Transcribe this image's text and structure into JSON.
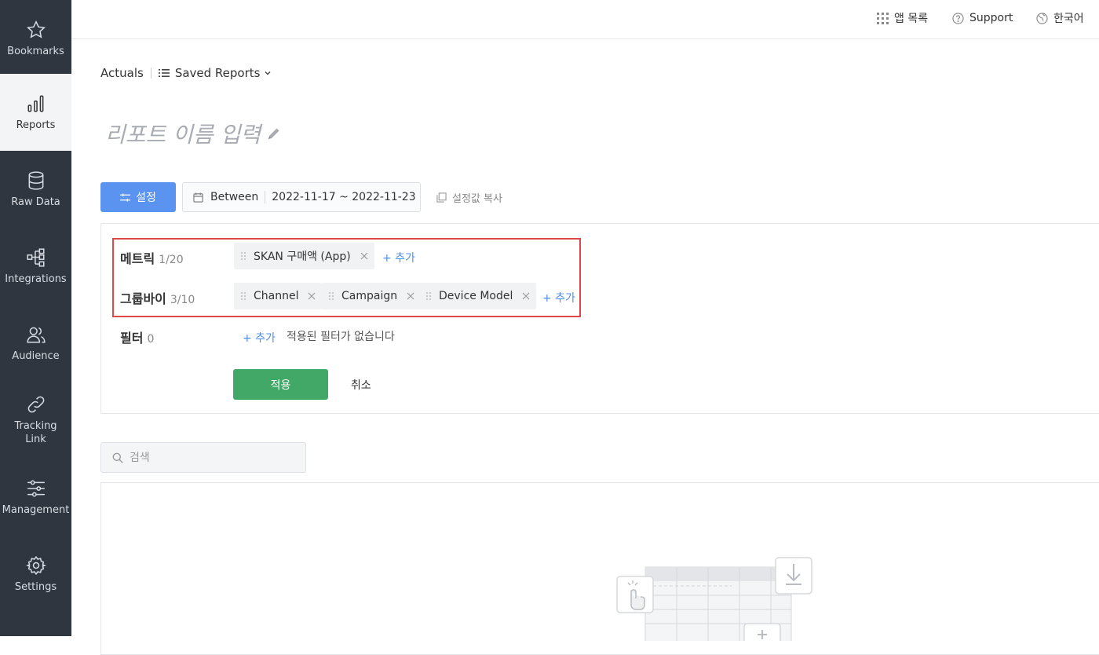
{
  "sidebar": {
    "items": [
      {
        "label": "Bookmarks",
        "icon": "star-icon"
      },
      {
        "label": "Reports",
        "icon": "bar-chart-icon"
      },
      {
        "label": "Raw Data",
        "icon": "database-icon"
      },
      {
        "label": "Integrations",
        "icon": "network-icon"
      },
      {
        "label": "Audience",
        "icon": "users-icon"
      },
      {
        "label": "Tracking Link",
        "icon": "link-icon"
      },
      {
        "label": "Management",
        "icon": "sliders-icon"
      },
      {
        "label": "Settings",
        "icon": "gear-icon"
      }
    ],
    "active": "Reports"
  },
  "topbar": {
    "apps_label": "앱 목록",
    "support_label": "Support",
    "language_label": "한국어"
  },
  "breadcrumb": {
    "current": "Actuals",
    "saved_reports_label": "Saved Reports"
  },
  "report": {
    "title_placeholder": "리포트 이름 입력"
  },
  "toolbar": {
    "settings_label": "설정",
    "date_mode": "Between",
    "date_range": "2022-11-17 ~ 2022-11-23",
    "copy_label": "설정값 복사"
  },
  "config": {
    "metrics": {
      "label": "메트릭",
      "count": "1/20",
      "chips": [
        "SKAN 구매액 (App)"
      ],
      "add_label": "+ 추가"
    },
    "groupby": {
      "label": "그룹바이",
      "count": "3/10",
      "chips": [
        "Channel",
        "Campaign",
        "Device Model"
      ],
      "add_label": "+ 추가"
    },
    "filter": {
      "label": "필터",
      "count": "0",
      "add_label": "+ 추가",
      "empty_text": "적용된 필터가 없습니다"
    },
    "apply_label": "적용",
    "cancel_label": "취소"
  },
  "search": {
    "placeholder": "검색"
  },
  "colors": {
    "sidebar_bg": "#2f3640",
    "primary_blue": "#5b93f0",
    "apply_green": "#42a867",
    "highlight_red": "#e0474a",
    "link_blue": "#4a8ef0"
  }
}
